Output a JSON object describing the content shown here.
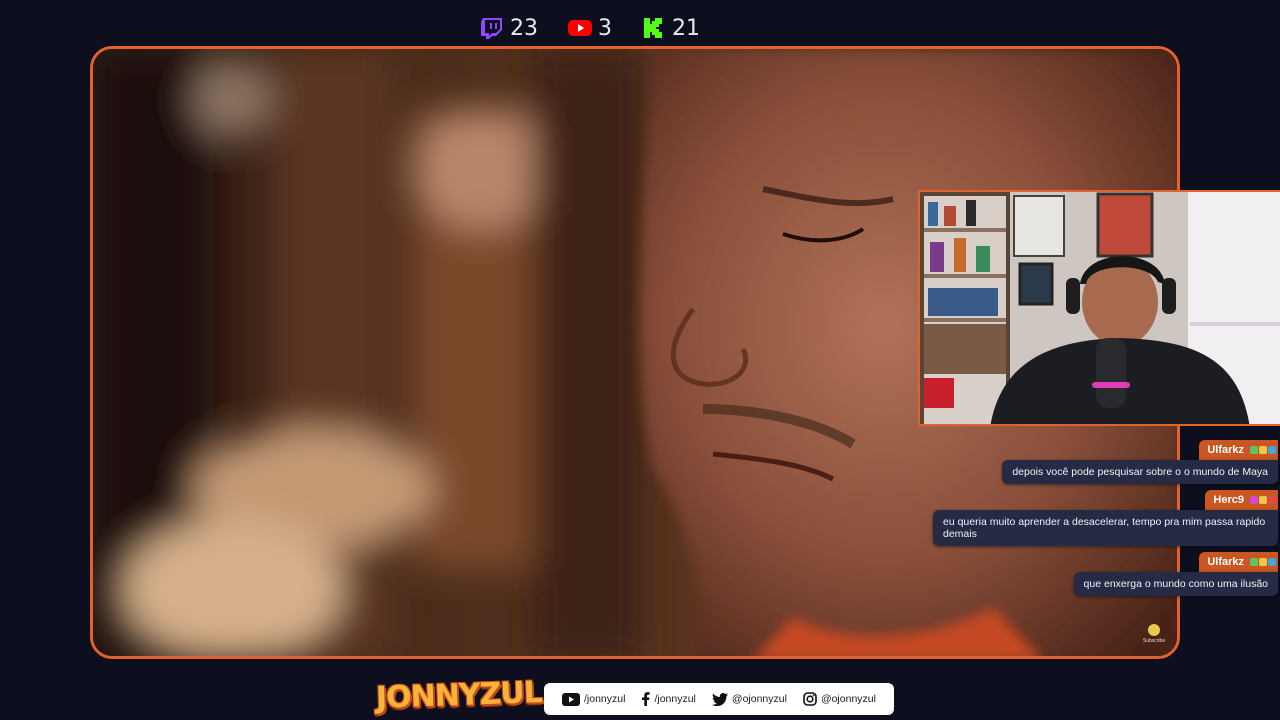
{
  "viewers": {
    "twitch": {
      "icon": "twitch-icon",
      "count": "23",
      "color": "#9146ff"
    },
    "youtube": {
      "icon": "youtube-icon",
      "count": "3",
      "color": "#ff0000"
    },
    "kick": {
      "icon": "kick-icon",
      "count": "21",
      "color": "#53fc18"
    }
  },
  "chat": {
    "messages": [
      {
        "user": "Ulfarkz",
        "text": "depois você pode pesquisar sobre o o mundo de Maya"
      },
      {
        "user": "Herc9",
        "text": "eu queria muito aprender a desacelerar, tempo pra mim passa rapido demais"
      },
      {
        "user": "Ulfarkz",
        "text": "que enxerga o mundo como uma ilusão"
      }
    ]
  },
  "subscribe_label": "Subscribe",
  "logo_text": "JONNYZUL",
  "socials": [
    {
      "icon": "youtube-icon",
      "handle": "/jonnyzul"
    },
    {
      "icon": "facebook-icon",
      "handle": "/jonnyzul"
    },
    {
      "icon": "twitter-icon",
      "handle": "@ojonnyzul"
    },
    {
      "icon": "instagram-icon",
      "handle": "@ojonnyzul"
    }
  ],
  "colors": {
    "accent": "#e2612c",
    "background": "#0d0f1f",
    "chat_bubble": "#252a45"
  }
}
